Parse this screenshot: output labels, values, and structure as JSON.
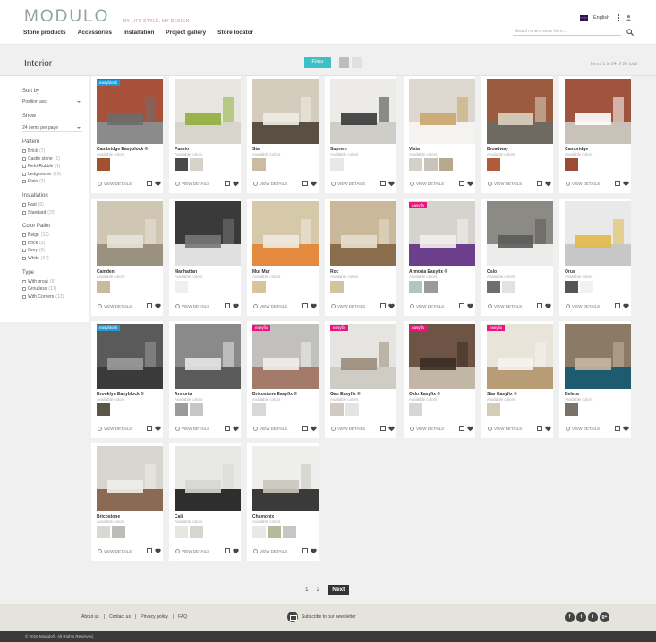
{
  "header": {
    "logo": "MODULO",
    "tagline": "MY LIFE STYLE, MY DESIGN",
    "nav": [
      "Stone products",
      "Accessories",
      "Installation",
      "Project gallery",
      "Store locator"
    ],
    "language": "English",
    "search_placeholder": "Search entire store here..."
  },
  "toolbar": {
    "page_title": "Interior",
    "filter_label": "Filter",
    "item_count": "Items 1 to 24 of 26 total"
  },
  "sidebar": {
    "sort_heading": "Sort by",
    "sort_value": "Position asc.",
    "show_heading": "Show",
    "show_value": "24 items per page",
    "groups": [
      {
        "heading": "Pattern",
        "options": [
          {
            "label": "Brick",
            "count": "(7)"
          },
          {
            "label": "Castle stone",
            "count": "(1)"
          },
          {
            "label": "Field-Rubble",
            "count": "(1)"
          },
          {
            "label": "Ledgestone",
            "count": "(15)"
          },
          {
            "label": "Plain",
            "count": "(2)"
          }
        ]
      },
      {
        "heading": "Installation",
        "options": [
          {
            "label": "Fast",
            "count": "(6)"
          },
          {
            "label": "Standard",
            "count": "(20)"
          }
        ]
      },
      {
        "heading": "Color Pallet",
        "options": [
          {
            "label": "Beige",
            "count": "(12)"
          },
          {
            "label": "Brick",
            "count": "(5)"
          },
          {
            "label": "Grey",
            "count": "(9)"
          },
          {
            "label": "White",
            "count": "(14)"
          }
        ]
      },
      {
        "heading": "Type",
        "options": [
          {
            "label": "With grout",
            "count": "(9)"
          },
          {
            "label": "Groutless",
            "count": "(17)"
          },
          {
            "label": "With Corners",
            "count": "(12)"
          }
        ]
      }
    ]
  },
  "product_labels": {
    "available": "Available colors",
    "view_details": "VIEW DETAILS"
  },
  "products": [
    {
      "name": "Cambridge Easyblock ®",
      "badge": "easyblock",
      "badge_color": "#1e9ad6",
      "scene": [
        "#a8513a",
        "#8b8b8b",
        "#6d6d6d"
      ],
      "swatches": [
        "#a0522d"
      ]
    },
    {
      "name": "Passio",
      "badge": "",
      "badge_color": "",
      "scene": [
        "#e8e6e0",
        "#d8d5cc",
        "#8fae3a"
      ],
      "swatches": [
        "#4a4a4a",
        "#d6d2c8"
      ]
    },
    {
      "name": "Star",
      "badge": "",
      "badge_color": "",
      "scene": [
        "#d4cdbd",
        "#5a4f42",
        "#f0ede6"
      ],
      "swatches": [
        "#cbbba3"
      ]
    },
    {
      "name": "Suprem",
      "badge": "",
      "badge_color": "",
      "scene": [
        "#ecebe8",
        "#cfcdc8",
        "#3a3a3a"
      ],
      "swatches": [
        "#e8e8e6"
      ]
    },
    {
      "name": "Vista",
      "badge": "",
      "badge_color": "",
      "scene": [
        "#dcd8cf",
        "#f5f3ef",
        "#c9a66b"
      ],
      "swatches": [
        "#d4d1cb",
        "#c9c4ba",
        "#b6a98e"
      ]
    },
    {
      "name": "Broadway",
      "badge": "",
      "badge_color": "",
      "scene": [
        "#9a5b3e",
        "#6e6a62",
        "#d9d2c2"
      ],
      "swatches": [
        "#b25a3a"
      ]
    },
    {
      "name": "Cambridge",
      "badge": "",
      "badge_color": "",
      "scene": [
        "#a0543f",
        "#c8c2b8",
        "#ffffff"
      ],
      "swatches": [
        "#9c4a33"
      ]
    },
    {
      "name": "Camden",
      "badge": "",
      "badge_color": "",
      "scene": [
        "#cfc6b4",
        "#9a927f",
        "#e7e3da"
      ],
      "swatches": [
        "#c8bb9a"
      ]
    },
    {
      "name": "Manhattan",
      "badge": "",
      "badge_color": "",
      "scene": [
        "#3a3a3a",
        "#e0e0e0",
        "#777777"
      ],
      "swatches": [
        "#f0f0f0"
      ]
    },
    {
      "name": "Mur Mur",
      "badge": "",
      "badge_color": "",
      "scene": [
        "#d6c9aa",
        "#e38a3e",
        "#efeae0"
      ],
      "swatches": [
        "#d8c49b"
      ]
    },
    {
      "name": "Roc",
      "badge": "",
      "badge_color": "",
      "scene": [
        "#c9b99a",
        "#8a6e4b",
        "#e6dfcf"
      ],
      "swatches": [
        "#d4c3a0"
      ]
    },
    {
      "name": "Armoria Easyfix ®",
      "badge": "easyfix",
      "badge_color": "#e8177f",
      "scene": [
        "#d6d3ce",
        "#6b3f8c",
        "#f2f0ec"
      ],
      "swatches": [
        "#a8c9c4",
        "#9a9a9a"
      ]
    },
    {
      "name": "Oslo",
      "badge": "",
      "badge_color": "",
      "scene": [
        "#8c8a84",
        "#ececea",
        "#5a5a5a"
      ],
      "swatches": [
        "#6e6e6e",
        "#e4e2dc"
      ]
    },
    {
      "name": "Orus",
      "badge": "",
      "badge_color": "",
      "scene": [
        "#e9e9e9",
        "#c7c7c7",
        "#e0b94a"
      ],
      "swatches": [
        "#555555",
        "#f2f2f2"
      ]
    },
    {
      "name": "Brooklyn Easyblock ®",
      "badge": "easyblock",
      "badge_color": "#1e9ad6",
      "scene": [
        "#5a5a5a",
        "#3a3a3a",
        "#9a9a9a"
      ],
      "swatches": [
        "#5a5544"
      ]
    },
    {
      "name": "Armoria",
      "badge": "",
      "badge_color": "",
      "scene": [
        "#8a8a8a",
        "#5a5a5a",
        "#e6e6e6"
      ],
      "swatches": [
        "#9a9a9a",
        "#c6c6c6"
      ]
    },
    {
      "name": "Bricostone Easyfix ®",
      "badge": "easyfix",
      "badge_color": "#e8177f",
      "scene": [
        "#c2c0bc",
        "#a47a6a",
        "#efeeeb"
      ],
      "swatches": [
        "#d8d8d6"
      ]
    },
    {
      "name": "Gao Easyfix ®",
      "badge": "easyfix",
      "badge_color": "#e8177f",
      "scene": [
        "#e6e4e0",
        "#cfccc6",
        "#9b8c7a"
      ],
      "swatches": [
        "#cfcbc2",
        "#e4e4e2"
      ]
    },
    {
      "name": "Oslo Easyfix ®",
      "badge": "easyfix",
      "badge_color": "#e8177f",
      "scene": [
        "#6e5444",
        "#c2b6a6",
        "#3a2e26"
      ],
      "swatches": [
        "#d6d6d2"
      ]
    },
    {
      "name": "Star Easyfix ®",
      "badge": "easyfix",
      "badge_color": "#e8177f",
      "scene": [
        "#e8e4da",
        "#b79c75",
        "#f5f3ee"
      ],
      "swatches": [
        "#d4ccb8"
      ]
    },
    {
      "name": "Beleza",
      "badge": "",
      "badge_color": "",
      "scene": [
        "#8a7a66",
        "#1f5b6e",
        "#c6b6a0"
      ],
      "swatches": [
        "#7a7268"
      ]
    },
    {
      "name": "Bricostone",
      "badge": "",
      "badge_color": "",
      "scene": [
        "#d8d4ce",
        "#8a6a52",
        "#f0eee9"
      ],
      "swatches": [
        "#d8d8d4",
        "#bcbcb8"
      ]
    },
    {
      "name": "Cali",
      "badge": "",
      "badge_color": "",
      "scene": [
        "#e8e8e6",
        "#2e2e2e",
        "#d6d6d2"
      ],
      "swatches": [
        "#e8e6e0",
        "#d6d6d0"
      ]
    },
    {
      "name": "Chamonix",
      "badge": "",
      "badge_color": "",
      "scene": [
        "#eeeeec",
        "#3a3a3a",
        "#c9c5bd"
      ],
      "swatches": [
        "#e8e8e6",
        "#b8b89a",
        "#c6c6c2"
      ]
    }
  ],
  "pagination": {
    "pages": [
      "1",
      "2"
    ],
    "next": "Next"
  },
  "footer": {
    "links": [
      "About us",
      "|",
      "Contact us",
      "|",
      "Privacy policy",
      "|",
      "FAQ"
    ],
    "newsletter": "Subscribe to our newsletter",
    "social": [
      "f",
      "t",
      "i",
      "g+"
    ],
    "copyright": "© 2016 Modulo®. All Rights Reserved."
  },
  "colors": {
    "accent": "#3ec1c6",
    "easyblock": "#1e9ad6",
    "easyfix": "#e8177f",
    "footer": "#e4e3dc"
  }
}
